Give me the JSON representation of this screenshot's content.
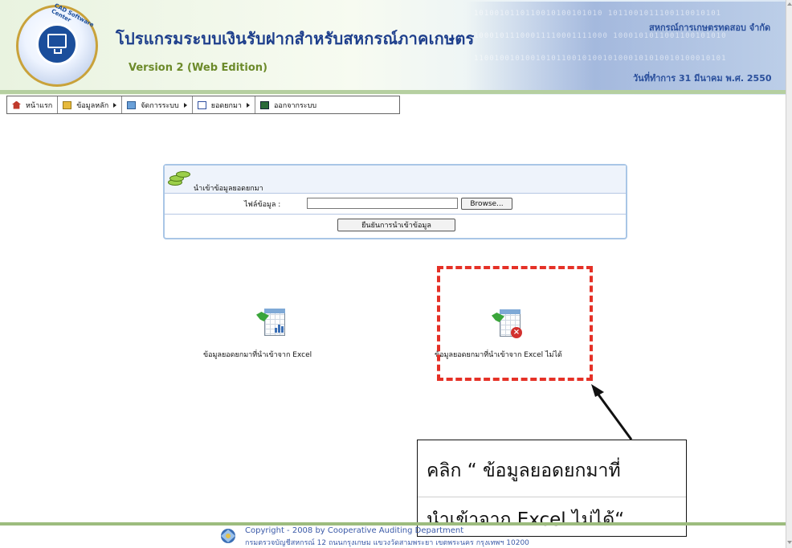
{
  "header": {
    "title": "โปรแกรมระบบเงินรับฝากสำหรับสหกรณ์ภาคเกษตร",
    "version": "Version 2 (Web Edition)",
    "cooperative_name": "สหกรณ์การเกษตรทดสอบ จำกัด",
    "work_date": "วันที่ทำการ 31 มีนาคม พ.ศ. 2550",
    "logo_text": "CAD Software Center",
    "binary_pattern": [
      "1010010110110010100101010 1011001011100110010101",
      "10001011100011110001111000 1000101011001100101010",
      "1100100101001010110010100101000101010010100010101"
    ]
  },
  "menu": {
    "items": [
      {
        "label": "หน้าแรก",
        "icon": "home-icon",
        "has_submenu": false
      },
      {
        "label": "ข้อมูลหลัก",
        "icon": "folder-icon",
        "has_submenu": true
      },
      {
        "label": "จัดการระบบ",
        "icon": "system-icon",
        "has_submenu": true
      },
      {
        "label": "ยอดยกมา",
        "icon": "report-icon",
        "has_submenu": true
      },
      {
        "label": "ออกจากระบบ",
        "icon": "exit-icon",
        "has_submenu": false
      }
    ]
  },
  "import_panel": {
    "title": "นำเข้าข้อมูลยอดยกมา",
    "file_label": "ไฟล์ข้อมูล :",
    "file_value": "",
    "browse_label": "Browse...",
    "confirm_label": "ยืนยันการนำเข้าข้อมูล"
  },
  "links": {
    "imported": "ข้อมูลยอดยกมาที่นำเข้าจาก Excel",
    "failed": "ข้อมูลยอดยกมาที่นำเข้าจาก Excel ไม่ได้"
  },
  "annotation": {
    "line1": "คลิก “ ข้อมูลยอดยกมาที่",
    "line2": "นำเข้าจาก Excel ไม่ได้“",
    "highlight_color": "#e53127"
  },
  "footer": {
    "copyright": "Copyright - 2008 by Cooperative Auditing Department",
    "address": "กรมตรวจบัญชีสหกรณ์ 12 ถนนกรุงเกษม แขวงวัดสามพระยา เขตพระนคร กรุงเทพฯ 10200"
  },
  "colors": {
    "title": "#1e3f8c",
    "version": "#6c8a2a",
    "panel_border": "#a9c6e6",
    "footer_text": "#3b5aa8"
  }
}
